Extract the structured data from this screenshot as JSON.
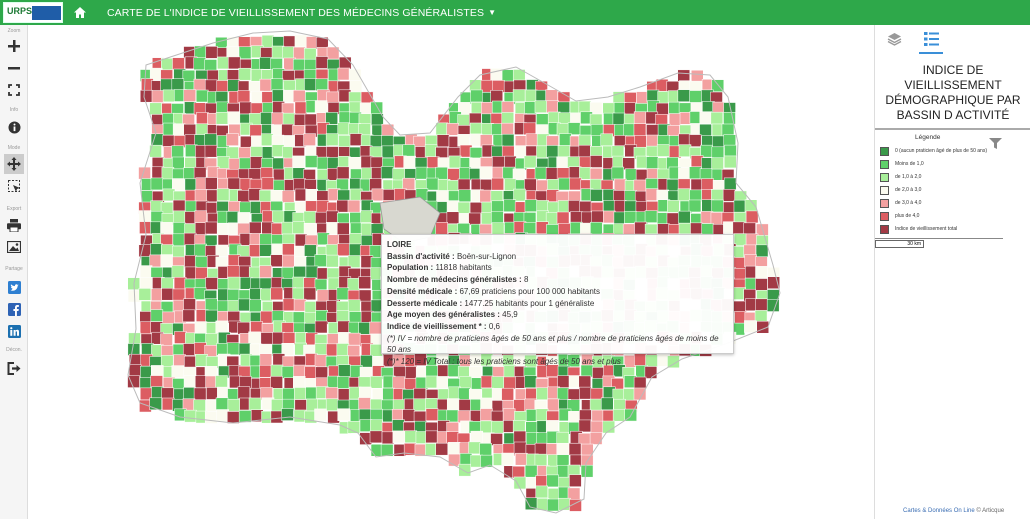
{
  "header": {
    "title": "CARTE DE L'INDICE DE VIEILLISSEMENT DES MÉDECINS GÉNÉRALISTES",
    "logo_text": "URPS"
  },
  "toolbar": {
    "groups": [
      "Zoom",
      "Info",
      "Mode",
      "Export",
      "Partage",
      "Décon."
    ]
  },
  "tooltip": {
    "name": "LOIRE",
    "rows": [
      {
        "label": "Bassin d'activité :",
        "value": "Boën-sur-Lignon"
      },
      {
        "label": "Population :",
        "value": "11818 habitants"
      },
      {
        "label": "Nombre de médecins généralistes :",
        "value": "8"
      },
      {
        "label": "Densité médicale :",
        "value": "67,69 praticiens pour 100 000 habitants"
      },
      {
        "label": "Desserte médicale :",
        "value": "1477.25 habitants pour 1 généraliste"
      },
      {
        "label": "Age moyen des généralistes :",
        "value": "45,9"
      },
      {
        "label": "Indice de vieillissement * :",
        "value": "0,6"
      }
    ],
    "note1": "(*) IV = nombre de praticiens âgés de 50 ans et plus / nombre de praticiens âgés de moins de 50 ans",
    "note2": "(*)* 120 = IV Total : tous les praticiens sont âgés de 50 ans et plus"
  },
  "panel": {
    "title": "INDICE DE VIEILLISSEMENT DÉMOGRAPHIQUE PAR BASSIN D ACTIVITÉ",
    "legend_title": "Légende",
    "legend": [
      {
        "label": "0 (aucun praticien âgé de plus de 50 ans)",
        "color": "#3a9a4a"
      },
      {
        "label": "Moins de 1,0",
        "color": "#5fd06a"
      },
      {
        "label": "de 1,0 à 2,0",
        "color": "#a8ef9a"
      },
      {
        "label": "de 2,0 à 3,0",
        "color": "#fbfbf0"
      },
      {
        "label": "de 3,0 à 4,0",
        "color": "#f3a0a0"
      },
      {
        "label": "plus de 4,0",
        "color": "#dc5d62"
      },
      {
        "label": "Indice de vieillissement total",
        "color": "#a23a45"
      }
    ],
    "scale": "30 km",
    "credit_link": "Cartes & Données On Line",
    "credit_rest": "© Articque"
  },
  "colors": {
    "header": "#2ea84a",
    "palette": [
      "#3a9a4a",
      "#5fd06a",
      "#a8ef9a",
      "#fbfbf0",
      "#f3a0a0",
      "#dc5d62",
      "#a23a45"
    ]
  }
}
